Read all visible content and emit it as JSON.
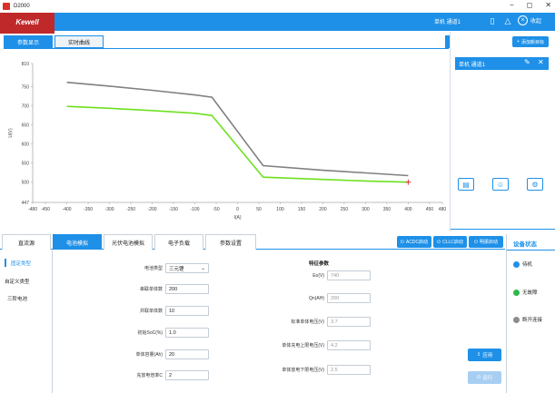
{
  "window": {
    "title": "D2000",
    "min": "−",
    "max": "◻",
    "close": "✕"
  },
  "header": {
    "brand": "Kewell",
    "device": "单机 通道1",
    "collapse_label": "收起"
  },
  "top_tabs": [
    {
      "label": "参数显示",
      "active": true
    },
    {
      "label": "实时曲线",
      "active": false
    }
  ],
  "right_panel": {
    "add_device": "添加新目标",
    "device_card": "单机 通道1"
  },
  "chart_data": {
    "type": "line",
    "xlabel": "I(A)",
    "ylabel": "U(V)",
    "xlim": [
      -480,
      480
    ],
    "ylim": [
      447,
      810
    ],
    "xticks": [
      -480,
      -450,
      -400,
      -350,
      -300,
      -250,
      -200,
      -150,
      -100,
      -50,
      0,
      50,
      100,
      150,
      200,
      250,
      300,
      350,
      400,
      450,
      480
    ],
    "yticks": [
      447,
      500,
      550,
      600,
      650,
      700,
      750,
      810
    ],
    "grid": false,
    "series": [
      {
        "color": "#808080",
        "x": [
          -400,
          -300,
          -200,
          -100,
          -60,
          60,
          200,
          300,
          400
        ],
        "y": [
          761,
          751,
          740,
          728,
          722,
          543,
          531,
          524,
          517
        ]
      },
      {
        "color": "#6ee020",
        "x": [
          -400,
          -300,
          -200,
          -100,
          -60,
          60,
          200,
          300,
          400
        ],
        "y": [
          698,
          693,
          687,
          680,
          674,
          513,
          507,
          503,
          500
        ]
      }
    ],
    "marker": {
      "x": 400,
      "y": 500,
      "symbol": "+",
      "color": "#e23b3b"
    }
  },
  "bottom_tabs": [
    {
      "label": "直流源",
      "active": false
    },
    {
      "label": "电池模拟",
      "active": true
    },
    {
      "label": "光伏电池模拟",
      "active": false
    },
    {
      "label": "电子负载",
      "active": false
    },
    {
      "label": "参数设置",
      "active": false
    }
  ],
  "start_buttons": [
    "ACDC启动",
    "CLLC启动",
    "明振启动"
  ],
  "left_nav": [
    {
      "label": "固定类型",
      "active": true
    },
    {
      "label": "自定义类型",
      "active": false
    },
    {
      "label": "三阶电池",
      "active": false
    }
  ],
  "form": {
    "battery_type_label": "电池类型",
    "battery_type_value": "三元锂",
    "series_label": "串联单体数",
    "series_value": "200",
    "parallel_label": "并联单体数",
    "parallel_value": "10",
    "soc_label": "初始SoC(%)",
    "soc_value": "1.0",
    "capacity_label": "单体容量(Ah)",
    "capacity_value": "20",
    "rate_label": "充放电倍率C",
    "rate_value": "2"
  },
  "feature": {
    "title": "特征参数",
    "eo_label": "Eo(V)",
    "eo_value": "740",
    "qn_label": "Qn(AH)",
    "qn_value": "200",
    "nominal_label": "标准单体电压(V)",
    "nominal_value": "3.7",
    "upper_label": "单体充电上限电压(V)",
    "upper_value": "4.2",
    "lower_label": "单体放电下限电压(V)",
    "lower_value": "2.5"
  },
  "actions": {
    "apply": "应用",
    "run": "运行"
  },
  "status": {
    "title": "设备状态",
    "items": [
      {
        "label": "待机",
        "color": "#1e90e8"
      },
      {
        "label": "无故障",
        "color": "#2db84a"
      },
      {
        "label": "断开连接",
        "color": "#8c8c8c"
      }
    ]
  }
}
